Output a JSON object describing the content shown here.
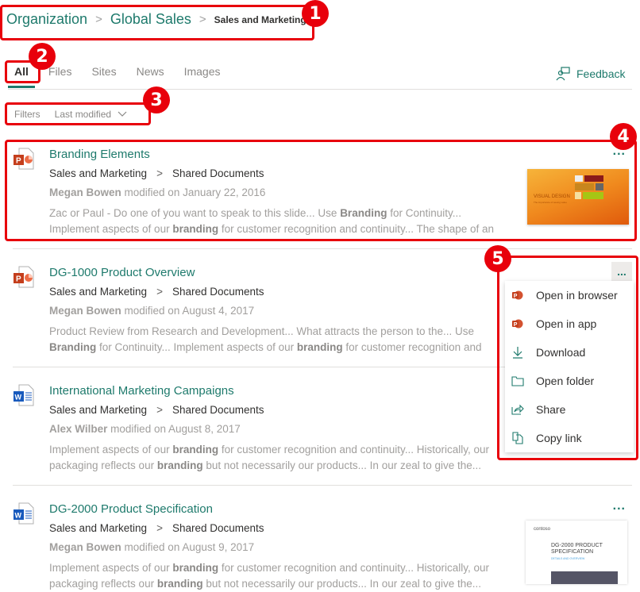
{
  "breadcrumb": [
    {
      "label": "Organization"
    },
    {
      "label": "Global Sales"
    },
    {
      "label": "Sales and Marketing"
    }
  ],
  "tabs": [
    {
      "label": "All",
      "active": true
    },
    {
      "label": "Files"
    },
    {
      "label": "Sites"
    },
    {
      "label": "News"
    },
    {
      "label": "Images"
    }
  ],
  "feedback": {
    "label": "Feedback",
    "icon": "feedback-person-icon"
  },
  "filters": {
    "label": "Filters",
    "selected": "Last modified",
    "icon": "chevron-down-icon"
  },
  "results": [
    {
      "title": "Branding Elements",
      "file_type": "powerpoint",
      "path": [
        "Sales and Marketing",
        "Shared Documents"
      ],
      "author": "Megan Bowen",
      "modified_text": "modified on January 22, 2016",
      "snippet_lines": [
        "Zac or Paul - Do one of you want to speak to this slide... Use <b>Branding</b> for Continuity...",
        "Implement aspects of our <b>branding</b> for customer recognition and continuity... The shape of an"
      ],
      "thumbnail": {
        "title": "VISUAL DESIGN",
        "subtitle": "The importance of seeing value"
      }
    },
    {
      "title": "DG-1000 Product Overview",
      "file_type": "powerpoint",
      "path": [
        "Sales and Marketing",
        "Shared Documents"
      ],
      "author": "Megan Bowen",
      "modified_text": "modified on August 4, 2017",
      "snippet_lines": [
        "Product Review from Research and Development... What attracts the person to the... Use",
        "<b>Branding</b> for Continuity... Implement aspects of our <b>branding</b> for customer recognition and"
      ]
    },
    {
      "title": "International Marketing Campaigns",
      "file_type": "word",
      "path": [
        "Sales and Marketing",
        "Shared Documents"
      ],
      "author": "Alex Wilber",
      "modified_text": "modified on August 8, 2017",
      "snippet_lines": [
        "Implement aspects of our <b>branding</b> for customer recognition and continuity... Historically, our",
        "packaging reflects our <b>branding</b> but not necessarily our products... In our zeal to give the..."
      ]
    },
    {
      "title": "DG-2000 Product Specification",
      "file_type": "word",
      "path": [
        "Sales and Marketing",
        "Shared Documents"
      ],
      "author": "Megan Bowen",
      "modified_text": "modified on August 9, 2017",
      "snippet_lines": [
        "Implement aspects of our <b>branding</b> for customer recognition and continuity... Historically, our",
        "packaging reflects our <b>branding</b> but not necessarily our products... In our zeal to give the..."
      ],
      "thumbnail": {
        "brand": "contoso",
        "title": "DG-2000 PRODUCT SPECIFICATION",
        "subtitle": "DETAILS AND OVERVIEW"
      }
    }
  ],
  "context_menu": [
    {
      "label": "Open in browser",
      "icon": "powerpoint-icon"
    },
    {
      "label": "Open in app",
      "icon": "powerpoint-icon"
    },
    {
      "label": "Download",
      "icon": "download-icon"
    },
    {
      "label": "Open folder",
      "icon": "folder-icon"
    },
    {
      "label": "Share",
      "icon": "share-icon"
    },
    {
      "label": "Copy link",
      "icon": "copy-link-icon"
    }
  ],
  "more_label": "...",
  "annotations": [
    "1",
    "2",
    "3",
    "4",
    "5"
  ],
  "colors": {
    "accent": "#1e7a6c",
    "annotation": "#e8000b",
    "powerpoint": "#c43e1c",
    "word": "#185abd"
  }
}
